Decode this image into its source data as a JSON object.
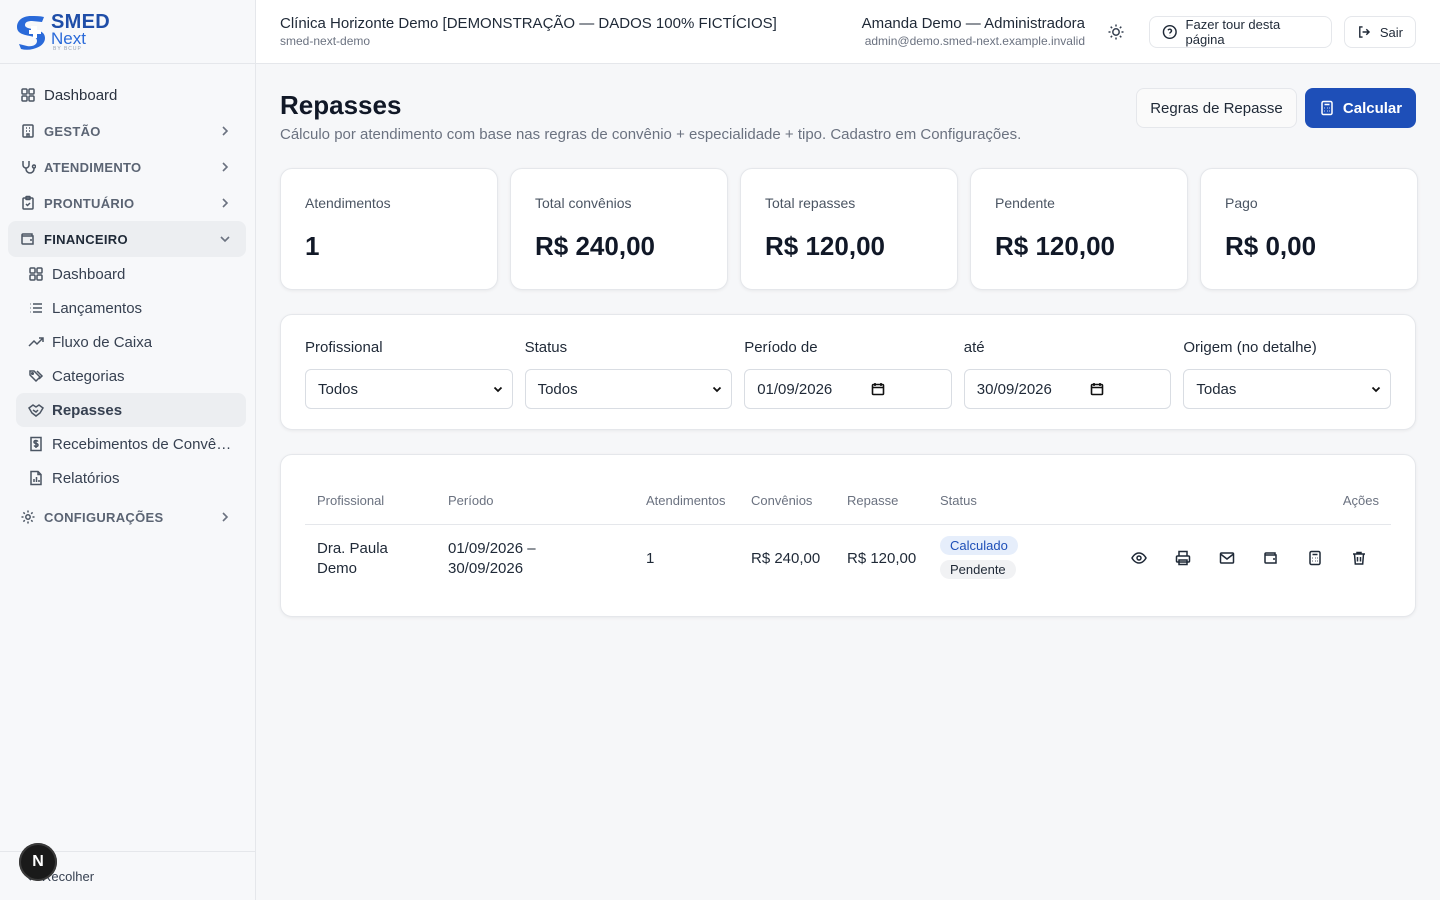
{
  "brand": {
    "name": "SMED",
    "product": "Next",
    "tagline": "BY BCUP"
  },
  "sidebar": {
    "items": [
      {
        "label": "Dashboard",
        "icon": "dashboard-icon"
      },
      {
        "label": "GESTÃO",
        "icon": "building-icon"
      },
      {
        "label": "ATENDIMENTO",
        "icon": "stethoscope-icon"
      },
      {
        "label": "PRONTUÁRIO",
        "icon": "clipboard-icon"
      },
      {
        "label": "FINANCEIRO",
        "icon": "wallet-icon"
      },
      {
        "label": "CONFIGURAÇÕES",
        "icon": "gear-icon"
      }
    ],
    "financeiro_sub": [
      {
        "label": "Dashboard",
        "icon": "dashboard-icon"
      },
      {
        "label": "Lançamentos",
        "icon": "list-icon"
      },
      {
        "label": "Fluxo de Caixa",
        "icon": "trend-icon"
      },
      {
        "label": "Categorias",
        "icon": "tags-icon"
      },
      {
        "label": "Repasses",
        "icon": "handshake-icon"
      },
      {
        "label": "Recebimentos de Convênios",
        "icon": "receipt-icon"
      },
      {
        "label": "Relatórios",
        "icon": "report-icon"
      }
    ],
    "collapse_label": "Recolher",
    "assistant_badge": "N"
  },
  "header": {
    "clinic_name": "Clínica Horizonte Demo [DEMONSTRAÇÃO — DADOS 100% FICTÍCIOS]",
    "clinic_slug": "smed-next-demo",
    "user_name": "Amanda Demo — Administradora",
    "user_email": "admin@demo.smed-next.example.invalid",
    "tour_label": "Fazer tour desta página",
    "exit_label": "Sair"
  },
  "page": {
    "title": "Repasses",
    "subtitle": "Cálculo por atendimento com base nas regras de convênio + especialidade + tipo. Cadastro em Configurações.",
    "rules_button": "Regras de Repasse",
    "calc_button": "Calcular"
  },
  "stats": [
    {
      "label": "Atendimentos",
      "value": "1"
    },
    {
      "label": "Total convênios",
      "value": "R$ 240,00"
    },
    {
      "label": "Total repasses",
      "value": "R$ 120,00"
    },
    {
      "label": "Pendente",
      "value": "R$ 120,00"
    },
    {
      "label": "Pago",
      "value": "R$ 0,00"
    }
  ],
  "filters": {
    "professional": {
      "label": "Profissional",
      "value": "Todos"
    },
    "status": {
      "label": "Status",
      "value": "Todos"
    },
    "from": {
      "label": "Período de",
      "value": "01/09/2026"
    },
    "to": {
      "label": "até",
      "value": "30/09/2026"
    },
    "origin": {
      "label": "Origem (no detalhe)",
      "value": "Todas"
    }
  },
  "table": {
    "columns": [
      "Profissional",
      "Período",
      "Atendimentos",
      "Convênios",
      "Repasse",
      "Status",
      "Ações"
    ],
    "rows": [
      {
        "professional_line1": "Dra. Paula",
        "professional_line2": "Demo",
        "period_line1": "01/09/2026 –",
        "period_line2": "30/09/2026",
        "attendances": "1",
        "insurances": "R$ 240,00",
        "transfer": "R$ 120,00",
        "status_calc": "Calculado",
        "status_pay": "Pendente"
      }
    ]
  },
  "colors": {
    "primary": "#1e4fb8",
    "brand_dark": "#1f4ea8",
    "badge_blue_bg": "#e6eefb"
  }
}
